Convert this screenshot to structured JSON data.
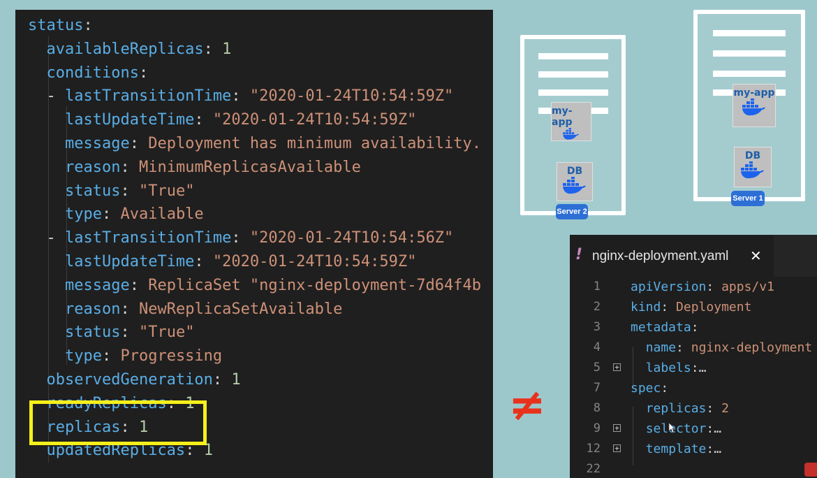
{
  "yaml_status": {
    "lines": [
      {
        "indent": "",
        "key": "status",
        "sep": ":",
        "value": "",
        "vtype": "p"
      },
      {
        "indent": "  ",
        "key": "availableReplicas",
        "sep": ": ",
        "value": "1",
        "vtype": "n"
      },
      {
        "indent": "  ",
        "key": "conditions",
        "sep": ":",
        "value": "",
        "vtype": "p"
      },
      {
        "indent": "  - ",
        "key": "lastTransitionTime",
        "sep": ": ",
        "value": "\"2020-01-24T10:54:59Z\"",
        "vtype": "s"
      },
      {
        "indent": "    ",
        "key": "lastUpdateTime",
        "sep": ": ",
        "value": "\"2020-01-24T10:54:59Z\"",
        "vtype": "s"
      },
      {
        "indent": "    ",
        "key": "message",
        "sep": ": ",
        "value": "Deployment has minimum availability.",
        "vtype": "s"
      },
      {
        "indent": "    ",
        "key": "reason",
        "sep": ": ",
        "value": "MinimumReplicasAvailable",
        "vtype": "s"
      },
      {
        "indent": "    ",
        "key": "status",
        "sep": ": ",
        "value": "\"True\"",
        "vtype": "s"
      },
      {
        "indent": "    ",
        "key": "type",
        "sep": ": ",
        "value": "Available",
        "vtype": "s"
      },
      {
        "indent": "  - ",
        "key": "lastTransitionTime",
        "sep": ": ",
        "value": "\"2020-01-24T10:54:56Z\"",
        "vtype": "s"
      },
      {
        "indent": "    ",
        "key": "lastUpdateTime",
        "sep": ": ",
        "value": "\"2020-01-24T10:54:59Z\"",
        "vtype": "s"
      },
      {
        "indent": "    ",
        "key": "message",
        "sep": ": ",
        "value": "ReplicaSet \"nginx-deployment-7d64f4b",
        "vtype": "s"
      },
      {
        "indent": "    ",
        "key": "reason",
        "sep": ": ",
        "value": "NewReplicaSetAvailable",
        "vtype": "s"
      },
      {
        "indent": "    ",
        "key": "status",
        "sep": ": ",
        "value": "\"True\"",
        "vtype": "s"
      },
      {
        "indent": "    ",
        "key": "type",
        "sep": ": ",
        "value": "Progressing",
        "vtype": "s"
      },
      {
        "indent": "  ",
        "key": "observedGeneration",
        "sep": ": ",
        "value": "1",
        "vtype": "n"
      },
      {
        "indent": "  ",
        "key": "readyReplicas",
        "sep": ": ",
        "value": "1",
        "vtype": "n"
      },
      {
        "indent": "  ",
        "key": "replicas",
        "sep": ": ",
        "value": "1",
        "vtype": "n"
      },
      {
        "indent": "  ",
        "key": "updatedReplicas",
        "sep": ": ",
        "value": "1",
        "vtype": "n"
      }
    ]
  },
  "servers": {
    "server2": {
      "badge": "Server 2",
      "app_label": "my-app",
      "db_label": "DB"
    },
    "server1": {
      "badge": "Server 1",
      "app_label": "my-app",
      "db_label": "DB"
    }
  },
  "not_equal_symbol": "≠",
  "editor": {
    "tab_marker": "!",
    "tab_title": "nginx-deployment.yaml",
    "tab_close": "✕",
    "lines": [
      {
        "num": "1",
        "fold": false,
        "indent": "",
        "key": "apiVersion",
        "sep": ": ",
        "value": "apps/v1"
      },
      {
        "num": "2",
        "fold": false,
        "indent": "",
        "key": "kind",
        "sep": ": ",
        "value": "Deployment"
      },
      {
        "num": "3",
        "fold": false,
        "indent": "",
        "key": "metadata",
        "sep": ":",
        "value": ""
      },
      {
        "num": "4",
        "fold": false,
        "indent": "  ",
        "key": "name",
        "sep": ": ",
        "value": "nginx-deployment"
      },
      {
        "num": "5",
        "fold": true,
        "indent": "  ",
        "key": "labels",
        "sep": ":",
        "value": "…"
      },
      {
        "num": "7",
        "fold": false,
        "indent": "",
        "key": "spec",
        "sep": ":",
        "value": ""
      },
      {
        "num": "8",
        "fold": false,
        "indent": "  ",
        "key": "replicas",
        "sep": ": ",
        "value": "2"
      },
      {
        "num": "9",
        "fold": true,
        "indent": "  ",
        "key": "selector",
        "sep": ":",
        "value": "…"
      },
      {
        "num": "12",
        "fold": true,
        "indent": "  ",
        "key": "template",
        "sep": ":",
        "value": "…"
      },
      {
        "num": "22",
        "fold": false,
        "indent": "",
        "key": "",
        "sep": "",
        "value": ""
      }
    ]
  },
  "colors": {
    "key": "#5aaee6",
    "string": "#ce9178",
    "number": "#b5cea8",
    "highlight": "#f6f01a",
    "not_equal": "#e8321c",
    "badge": "#2e6fd6"
  }
}
